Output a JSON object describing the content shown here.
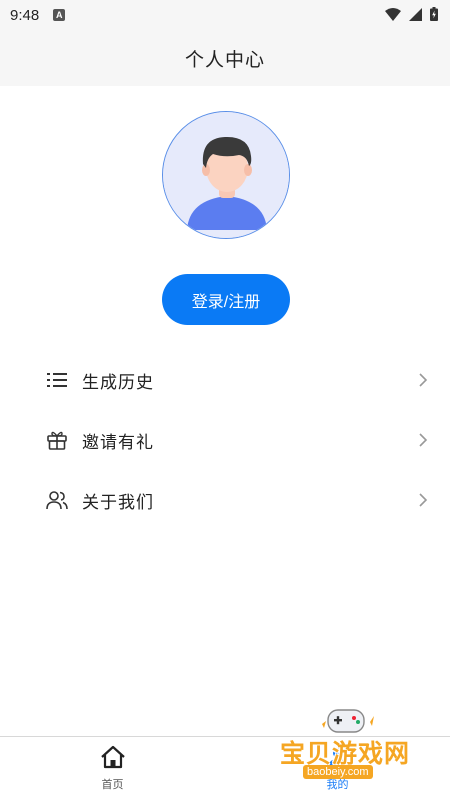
{
  "status_bar": {
    "time": "9:48",
    "notification_icon": "a-badge-icon",
    "wifi_icon": "wifi-icon",
    "signal_icon": "cellular-signal-icon",
    "battery_icon": "battery-charging-icon"
  },
  "header": {
    "title": "个人中心"
  },
  "profile": {
    "avatar_icon": "default-user-avatar-icon",
    "login_label": "登录/注册"
  },
  "menu": {
    "items": [
      {
        "label": "生成历史",
        "icon": "list-icon"
      },
      {
        "label": "邀请有礼",
        "icon": "gift-icon"
      },
      {
        "label": "关于我们",
        "icon": "users-icon"
      }
    ]
  },
  "tab_bar": {
    "tabs": [
      {
        "label": "首页",
        "icon": "home-icon",
        "active": false
      },
      {
        "label": "我的",
        "icon": "user-icon",
        "active": true
      }
    ]
  },
  "watermark": {
    "title": "宝贝游戏网",
    "url": "baobeiy.com"
  },
  "colors": {
    "accent": "#0a7af5",
    "header_bg": "#f6f6f6",
    "watermark": "#f5a623"
  }
}
